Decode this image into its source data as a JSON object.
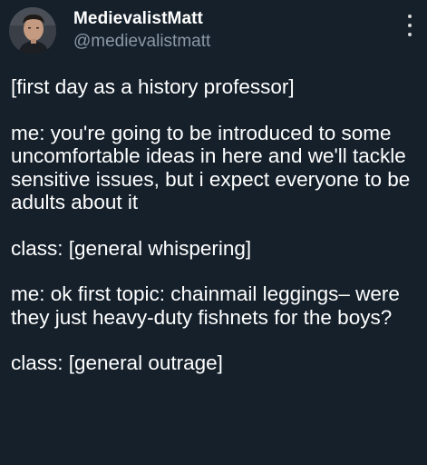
{
  "author": {
    "display_name": "MedievalistMatt",
    "handle": "@medievalistmatt",
    "avatar_icon": "profile-photo"
  },
  "menu": {
    "icon": "more-vertical-icon"
  },
  "tweet": {
    "paragraphs": [
      "[first day as a history professor]",
      "me: you're going to be introduced to some uncomfortable ideas in here and we'll tackle sensitive issues, but i expect everyone to be adults about it",
      "class: [general whispering]",
      "me: ok first topic: chainmail leggings– were they just heavy-duty fishnets for the boys?",
      "class: [general outrage]"
    ]
  },
  "colors": {
    "background": "#15202b",
    "text": "#ffffff",
    "secondary_text": "#8b98a5"
  }
}
